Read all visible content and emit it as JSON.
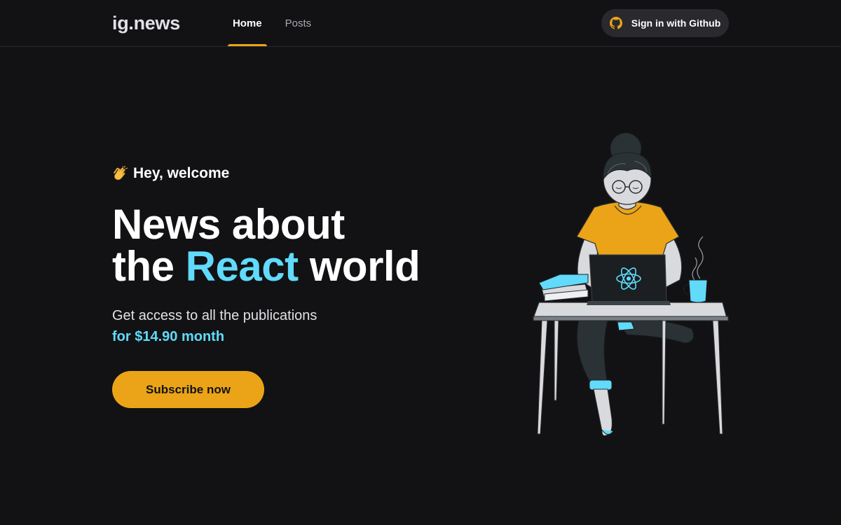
{
  "header": {
    "logo": "ig.news",
    "nav": [
      {
        "label": "Home",
        "active": true
      },
      {
        "label": "Posts",
        "active": false
      }
    ],
    "signin_label": "Sign in with Github",
    "signin_icon": "github-icon"
  },
  "hero": {
    "welcome_icon": "clapping-hands-icon",
    "welcome": "Hey, welcome",
    "headline_line1": "News about",
    "headline_the": "the",
    "headline_highlight": "React",
    "headline_end": "world",
    "access": "Get access to all the publications",
    "price": "for $14.90 month",
    "subscribe_label": "Subscribe now"
  },
  "colors": {
    "background": "#121214",
    "accent_yellow": "#eba417",
    "accent_cyan": "#61dafb",
    "button_dark": "#29292e"
  }
}
